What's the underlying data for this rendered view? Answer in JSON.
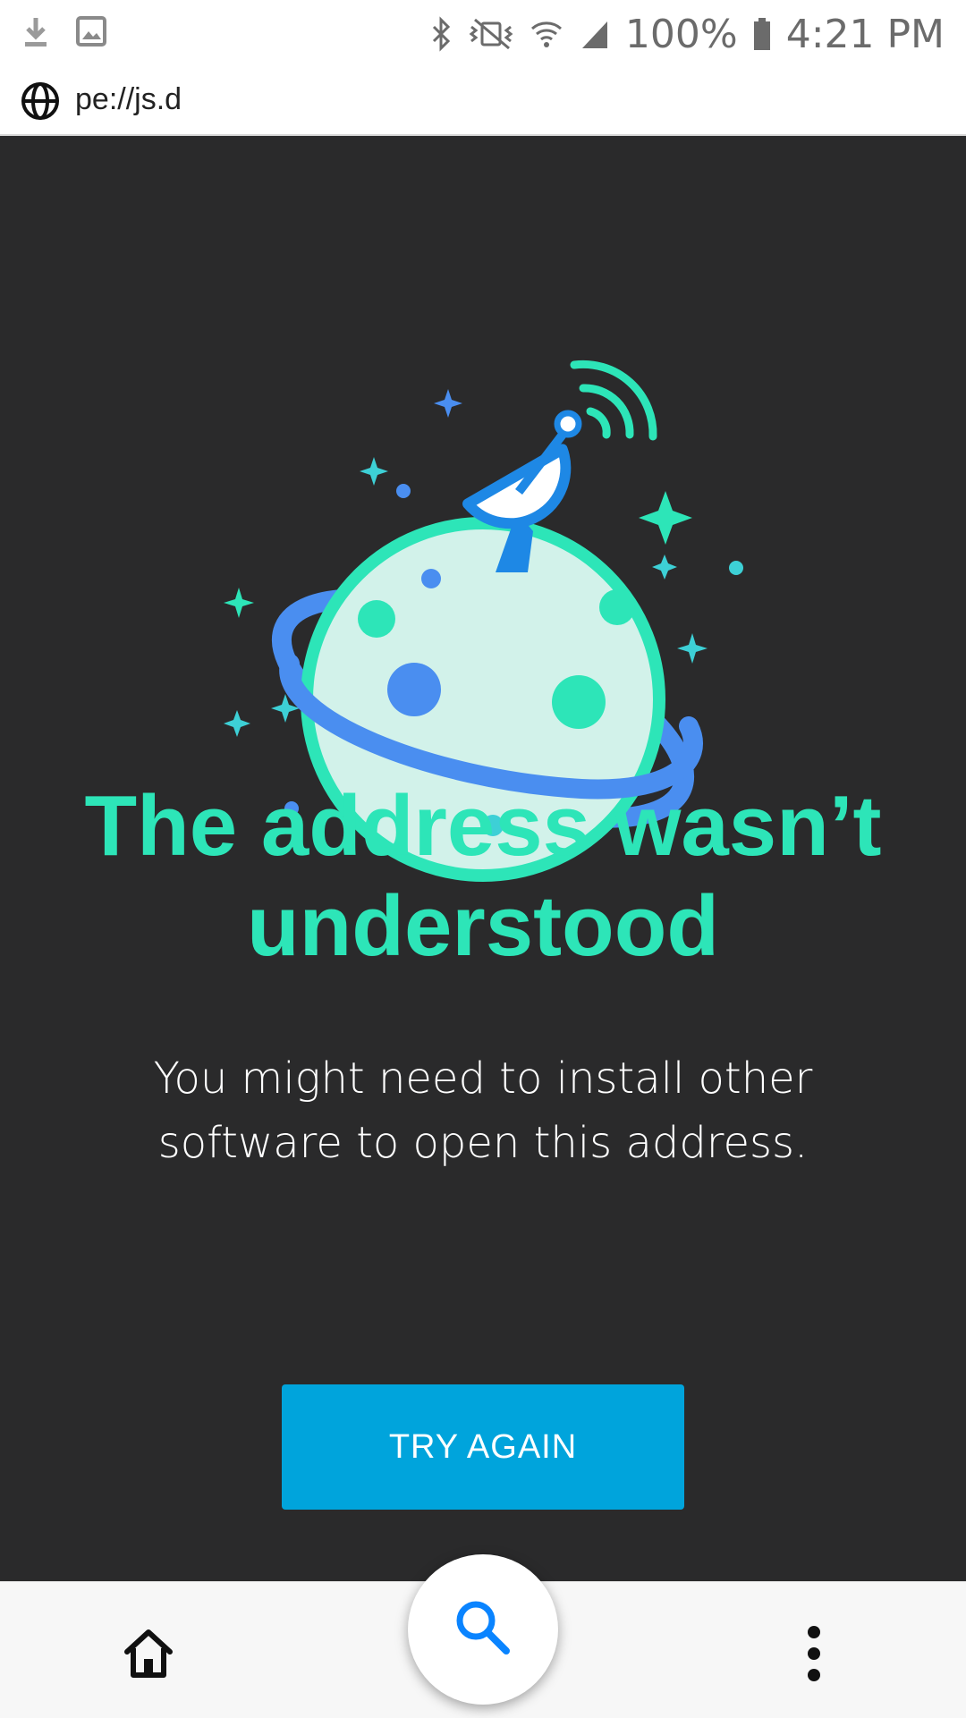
{
  "status_bar": {
    "battery_percent": "100%",
    "time": "4:21 PM",
    "icons": [
      "download-icon",
      "image-icon",
      "bluetooth-icon",
      "vibrate-icon",
      "wifi-icon",
      "signal-icon",
      "battery-icon"
    ]
  },
  "url_bar": {
    "icon": "globe-icon",
    "url": "pe://js.d"
  },
  "error_page": {
    "illustration": "planet-satellite-illustration",
    "title": "The address wasn’t understood",
    "message": "You might need to install other software to open this address.",
    "button_label": "TRY AGAIN"
  },
  "bottom_bar": {
    "home_icon": "home-icon",
    "search_icon": "search-icon",
    "menu_icon": "more-vert-icon"
  },
  "colors": {
    "background": "#2a2a2b",
    "title": "#2de5b8",
    "button": "#00a4dc",
    "search_icon": "#0a84ff"
  }
}
